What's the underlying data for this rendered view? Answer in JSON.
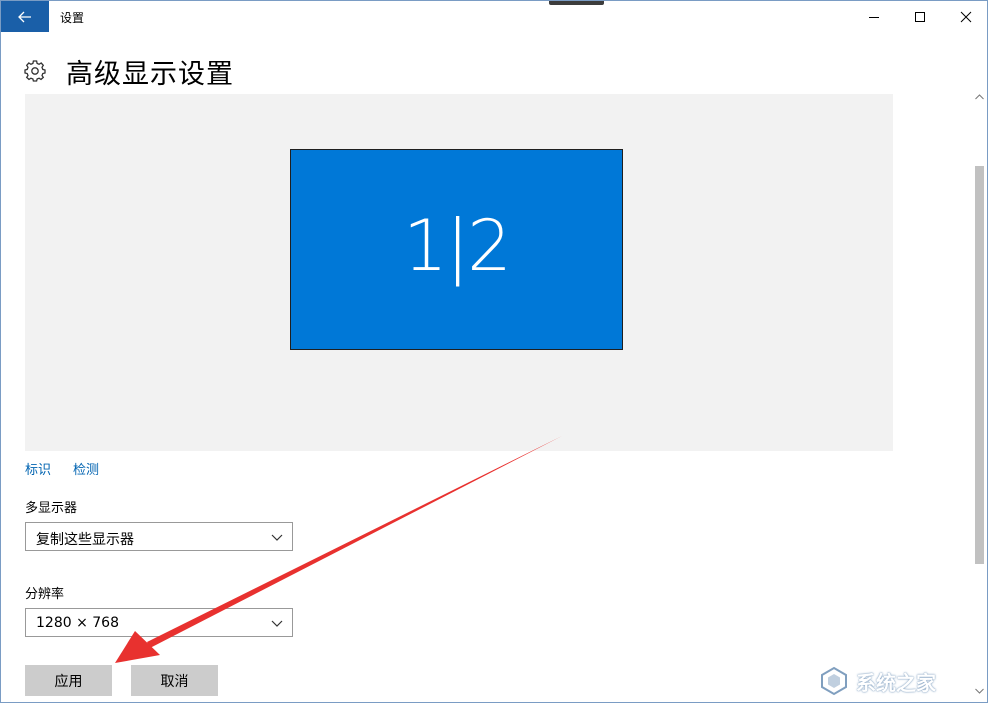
{
  "window": {
    "title": "设置"
  },
  "header": {
    "title": "高级显示设置",
    "icon": "gear-icon"
  },
  "preview": {
    "monitor_label": "1|2"
  },
  "links": {
    "identify": "标识",
    "detect": "检测"
  },
  "multi_display": {
    "label": "多显示器",
    "selected": "复制这些显示器"
  },
  "resolution": {
    "label": "分辨率",
    "selected": "1280 × 768"
  },
  "buttons": {
    "apply": "应用",
    "cancel": "取消"
  },
  "watermark": {
    "text": "系统之家"
  },
  "colors": {
    "accent": "#0078d7",
    "back_button": "#1a5fa8",
    "link": "#0063b1",
    "annotation_arrow": "#e8312f"
  }
}
